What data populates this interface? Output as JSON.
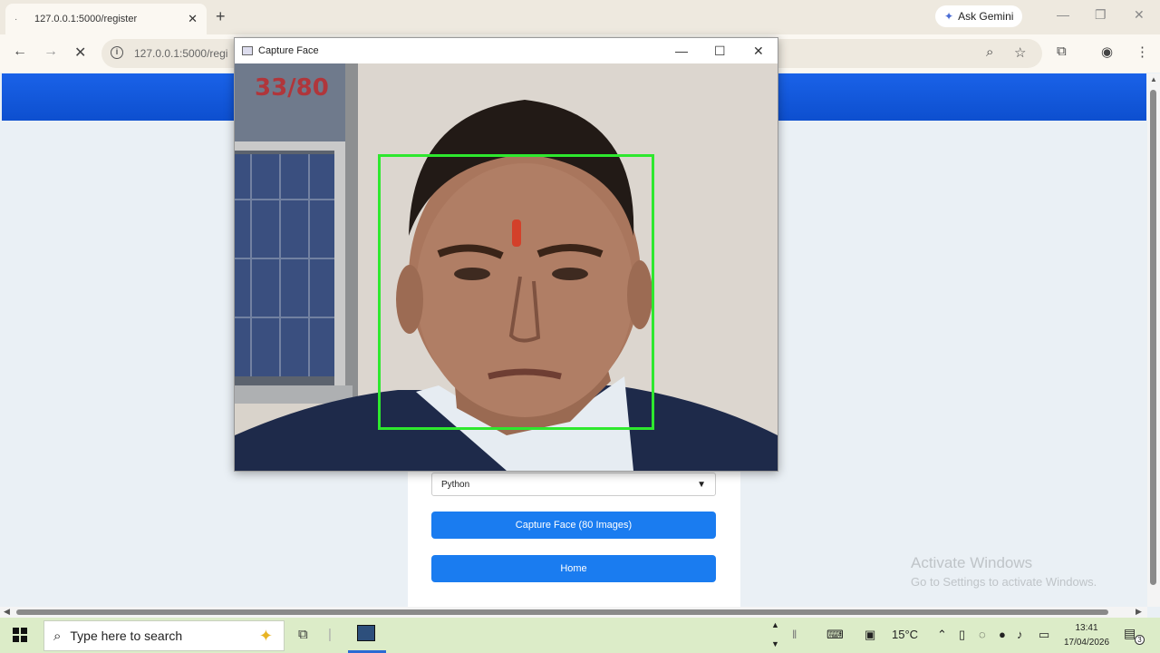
{
  "browser": {
    "tab_title": "127.0.0.1:5000/register",
    "tab_close": "✕",
    "new_tab": "+",
    "ask_gemini": "Ask Gemini",
    "url": "127.0.0.1:5000/regi",
    "window_controls": [
      "—",
      "❐",
      "✕"
    ]
  },
  "capture_window": {
    "title": "Capture Face",
    "counter": "33/80",
    "controls": [
      "—",
      "☐",
      "✕"
    ],
    "colors": {
      "box": "#2ee82e",
      "counter": "#cc1a1a"
    }
  },
  "form": {
    "course_select": "Python",
    "capture_button": "Capture Face (80 Images)",
    "home_button": "Home"
  },
  "watermark": {
    "line1": "Activate Windows",
    "line2": "Go to Settings to activate Windows."
  },
  "taskbar": {
    "search_placeholder": "Type here to search",
    "temperature": "15°C",
    "time": "13:41",
    "date": "17/04/2026",
    "notification_count": "3"
  },
  "colors": {
    "banner": "#1a62e8",
    "button": "#1a7cf0",
    "taskbar": "#dcecc8"
  }
}
